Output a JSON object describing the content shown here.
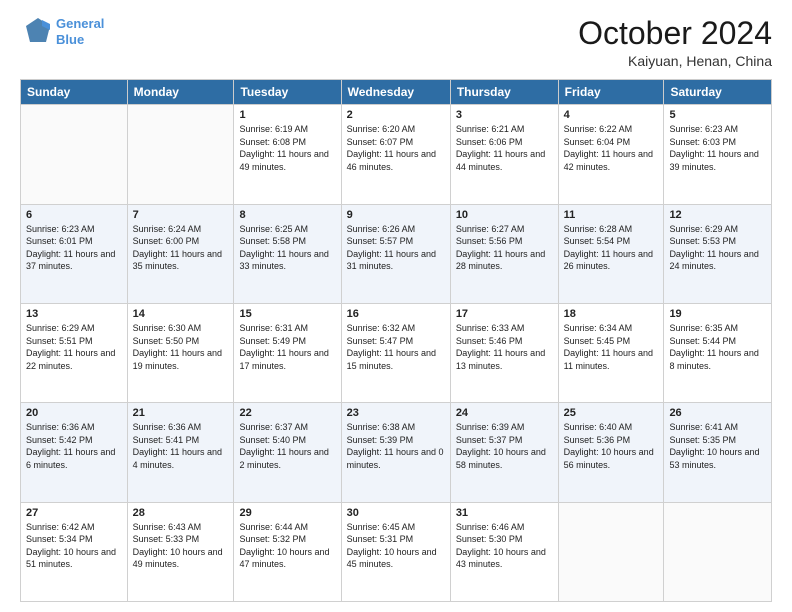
{
  "header": {
    "logo_line1": "General",
    "logo_line2": "Blue",
    "month": "October 2024",
    "location": "Kaiyuan, Henan, China"
  },
  "weekdays": [
    "Sunday",
    "Monday",
    "Tuesday",
    "Wednesday",
    "Thursday",
    "Friday",
    "Saturday"
  ],
  "weeks": [
    [
      {
        "day": "",
        "sunrise": "",
        "sunset": "",
        "daylight": ""
      },
      {
        "day": "",
        "sunrise": "",
        "sunset": "",
        "daylight": ""
      },
      {
        "day": "1",
        "sunrise": "Sunrise: 6:19 AM",
        "sunset": "Sunset: 6:08 PM",
        "daylight": "Daylight: 11 hours and 49 minutes."
      },
      {
        "day": "2",
        "sunrise": "Sunrise: 6:20 AM",
        "sunset": "Sunset: 6:07 PM",
        "daylight": "Daylight: 11 hours and 46 minutes."
      },
      {
        "day": "3",
        "sunrise": "Sunrise: 6:21 AM",
        "sunset": "Sunset: 6:06 PM",
        "daylight": "Daylight: 11 hours and 44 minutes."
      },
      {
        "day": "4",
        "sunrise": "Sunrise: 6:22 AM",
        "sunset": "Sunset: 6:04 PM",
        "daylight": "Daylight: 11 hours and 42 minutes."
      },
      {
        "day": "5",
        "sunrise": "Sunrise: 6:23 AM",
        "sunset": "Sunset: 6:03 PM",
        "daylight": "Daylight: 11 hours and 39 minutes."
      }
    ],
    [
      {
        "day": "6",
        "sunrise": "Sunrise: 6:23 AM",
        "sunset": "Sunset: 6:01 PM",
        "daylight": "Daylight: 11 hours and 37 minutes."
      },
      {
        "day": "7",
        "sunrise": "Sunrise: 6:24 AM",
        "sunset": "Sunset: 6:00 PM",
        "daylight": "Daylight: 11 hours and 35 minutes."
      },
      {
        "day": "8",
        "sunrise": "Sunrise: 6:25 AM",
        "sunset": "Sunset: 5:58 PM",
        "daylight": "Daylight: 11 hours and 33 minutes."
      },
      {
        "day": "9",
        "sunrise": "Sunrise: 6:26 AM",
        "sunset": "Sunset: 5:57 PM",
        "daylight": "Daylight: 11 hours and 31 minutes."
      },
      {
        "day": "10",
        "sunrise": "Sunrise: 6:27 AM",
        "sunset": "Sunset: 5:56 PM",
        "daylight": "Daylight: 11 hours and 28 minutes."
      },
      {
        "day": "11",
        "sunrise": "Sunrise: 6:28 AM",
        "sunset": "Sunset: 5:54 PM",
        "daylight": "Daylight: 11 hours and 26 minutes."
      },
      {
        "day": "12",
        "sunrise": "Sunrise: 6:29 AM",
        "sunset": "Sunset: 5:53 PM",
        "daylight": "Daylight: 11 hours and 24 minutes."
      }
    ],
    [
      {
        "day": "13",
        "sunrise": "Sunrise: 6:29 AM",
        "sunset": "Sunset: 5:51 PM",
        "daylight": "Daylight: 11 hours and 22 minutes."
      },
      {
        "day": "14",
        "sunrise": "Sunrise: 6:30 AM",
        "sunset": "Sunset: 5:50 PM",
        "daylight": "Daylight: 11 hours and 19 minutes."
      },
      {
        "day": "15",
        "sunrise": "Sunrise: 6:31 AM",
        "sunset": "Sunset: 5:49 PM",
        "daylight": "Daylight: 11 hours and 17 minutes."
      },
      {
        "day": "16",
        "sunrise": "Sunrise: 6:32 AM",
        "sunset": "Sunset: 5:47 PM",
        "daylight": "Daylight: 11 hours and 15 minutes."
      },
      {
        "day": "17",
        "sunrise": "Sunrise: 6:33 AM",
        "sunset": "Sunset: 5:46 PM",
        "daylight": "Daylight: 11 hours and 13 minutes."
      },
      {
        "day": "18",
        "sunrise": "Sunrise: 6:34 AM",
        "sunset": "Sunset: 5:45 PM",
        "daylight": "Daylight: 11 hours and 11 minutes."
      },
      {
        "day": "19",
        "sunrise": "Sunrise: 6:35 AM",
        "sunset": "Sunset: 5:44 PM",
        "daylight": "Daylight: 11 hours and 8 minutes."
      }
    ],
    [
      {
        "day": "20",
        "sunrise": "Sunrise: 6:36 AM",
        "sunset": "Sunset: 5:42 PM",
        "daylight": "Daylight: 11 hours and 6 minutes."
      },
      {
        "day": "21",
        "sunrise": "Sunrise: 6:36 AM",
        "sunset": "Sunset: 5:41 PM",
        "daylight": "Daylight: 11 hours and 4 minutes."
      },
      {
        "day": "22",
        "sunrise": "Sunrise: 6:37 AM",
        "sunset": "Sunset: 5:40 PM",
        "daylight": "Daylight: 11 hours and 2 minutes."
      },
      {
        "day": "23",
        "sunrise": "Sunrise: 6:38 AM",
        "sunset": "Sunset: 5:39 PM",
        "daylight": "Daylight: 11 hours and 0 minutes."
      },
      {
        "day": "24",
        "sunrise": "Sunrise: 6:39 AM",
        "sunset": "Sunset: 5:37 PM",
        "daylight": "Daylight: 10 hours and 58 minutes."
      },
      {
        "day": "25",
        "sunrise": "Sunrise: 6:40 AM",
        "sunset": "Sunset: 5:36 PM",
        "daylight": "Daylight: 10 hours and 56 minutes."
      },
      {
        "day": "26",
        "sunrise": "Sunrise: 6:41 AM",
        "sunset": "Sunset: 5:35 PM",
        "daylight": "Daylight: 10 hours and 53 minutes."
      }
    ],
    [
      {
        "day": "27",
        "sunrise": "Sunrise: 6:42 AM",
        "sunset": "Sunset: 5:34 PM",
        "daylight": "Daylight: 10 hours and 51 minutes."
      },
      {
        "day": "28",
        "sunrise": "Sunrise: 6:43 AM",
        "sunset": "Sunset: 5:33 PM",
        "daylight": "Daylight: 10 hours and 49 minutes."
      },
      {
        "day": "29",
        "sunrise": "Sunrise: 6:44 AM",
        "sunset": "Sunset: 5:32 PM",
        "daylight": "Daylight: 10 hours and 47 minutes."
      },
      {
        "day": "30",
        "sunrise": "Sunrise: 6:45 AM",
        "sunset": "Sunset: 5:31 PM",
        "daylight": "Daylight: 10 hours and 45 minutes."
      },
      {
        "day": "31",
        "sunrise": "Sunrise: 6:46 AM",
        "sunset": "Sunset: 5:30 PM",
        "daylight": "Daylight: 10 hours and 43 minutes."
      },
      {
        "day": "",
        "sunrise": "",
        "sunset": "",
        "daylight": ""
      },
      {
        "day": "",
        "sunrise": "",
        "sunset": "",
        "daylight": ""
      }
    ]
  ]
}
